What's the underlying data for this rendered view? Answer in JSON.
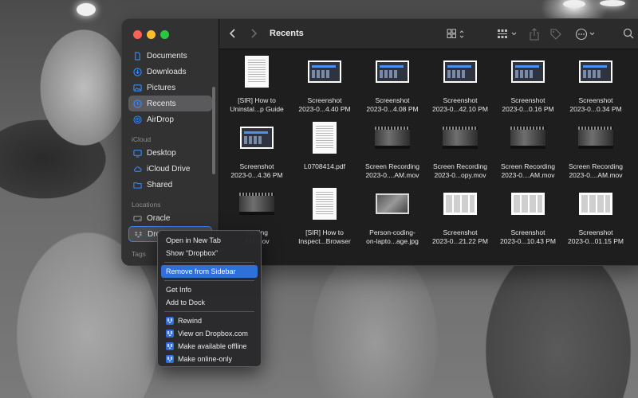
{
  "window": {
    "title": "Recents"
  },
  "sidebar": {
    "items": [
      {
        "label": "Documents",
        "icon": "document-icon"
      },
      {
        "label": "Downloads",
        "icon": "download-icon"
      },
      {
        "label": "Pictures",
        "icon": "pictures-icon"
      },
      {
        "label": "Recents",
        "icon": "clock-icon",
        "active": true
      },
      {
        "label": "AirDrop",
        "icon": "airdrop-icon"
      }
    ],
    "icloud_heading": "iCloud",
    "icloud_items": [
      {
        "label": "Desktop",
        "icon": "desktop-icon"
      },
      {
        "label": "iCloud Drive",
        "icon": "cloud-icon"
      },
      {
        "label": "Shared",
        "icon": "shared-folder-icon"
      }
    ],
    "locations_heading": "Locations",
    "location_items": [
      {
        "label": "Oracle",
        "icon": "disk-icon"
      },
      {
        "label": "Dro",
        "icon": "dropbox-icon"
      }
    ],
    "tags_heading": "Tags"
  },
  "files": [
    {
      "name1": "[SIR] How to",
      "name2": "Uninstal...p Guide",
      "kind": "doc"
    },
    {
      "name1": "Screenshot",
      "name2": "2023-0...4.40 PM",
      "kind": "shot"
    },
    {
      "name1": "Screenshot",
      "name2": "2023-0...4.08 PM",
      "kind": "shot"
    },
    {
      "name1": "Screenshot",
      "name2": "2023-0...42.10 PM",
      "kind": "shot"
    },
    {
      "name1": "Screenshot",
      "name2": "2023-0...0.16 PM",
      "kind": "shot"
    },
    {
      "name1": "Screenshot",
      "name2": "2023-0...0.34 PM",
      "kind": "shot"
    },
    {
      "name1": "Screenshot",
      "name2": "2023-0...4.36 PM",
      "kind": "shot"
    },
    {
      "name1": "L0708414.pdf",
      "name2": "",
      "kind": "doc"
    },
    {
      "name1": "Screen Recording",
      "name2": "2023-0....AM.mov",
      "kind": "video"
    },
    {
      "name1": "Screen Recording",
      "name2": "2023-0...opy.mov",
      "kind": "video"
    },
    {
      "name1": "Screen Recording",
      "name2": "2023-0....AM.mov",
      "kind": "video"
    },
    {
      "name1": "Screen Recording",
      "name2": "2023-0....AM.mov",
      "kind": "video"
    },
    {
      "name1": "cording",
      "name2": "AM.mov",
      "kind": "video"
    },
    {
      "name1": "[SIR] How to",
      "name2": "Inspect...Browser",
      "kind": "doc"
    },
    {
      "name1": "Person-coding-",
      "name2": "on-lapto...age.jpg",
      "kind": "photo"
    },
    {
      "name1": "Screenshot",
      "name2": "2023-0...21.22 PM",
      "kind": "web"
    },
    {
      "name1": "Screenshot",
      "name2": "2023-0...10.43 PM",
      "kind": "web"
    },
    {
      "name1": "Screenshot",
      "name2": "2023-0...01.15 PM",
      "kind": "web"
    }
  ],
  "context_menu": {
    "group1": [
      "Open in New Tab",
      "Show “Dropbox”"
    ],
    "group2": [
      "Remove from Sidebar"
    ],
    "group3": [
      "Get Info",
      "Add to Dock"
    ],
    "group4": [
      "Rewind",
      "View on Dropbox.com",
      "Make available offline",
      "Make online-only"
    ]
  },
  "colors": {
    "accent": "#2f6fd8",
    "sidebar_icon": "#3b8cf5"
  }
}
